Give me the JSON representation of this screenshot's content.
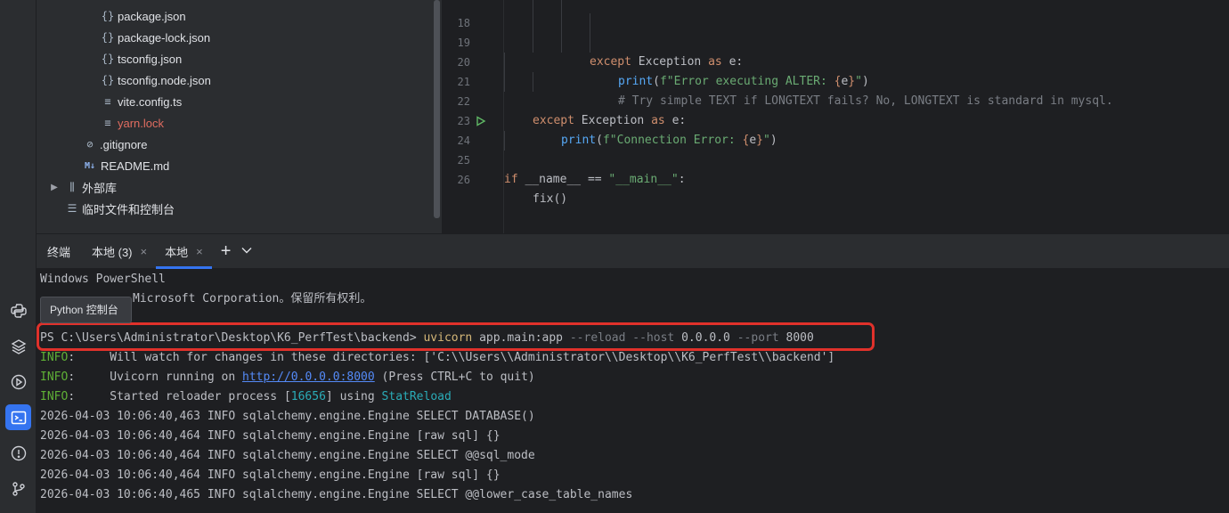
{
  "project_tree": {
    "items": [
      {
        "name": "package.json",
        "type": "json"
      },
      {
        "name": "package-lock.json",
        "type": "json"
      },
      {
        "name": "tsconfig.json",
        "type": "json"
      },
      {
        "name": "tsconfig.node.json",
        "type": "json"
      },
      {
        "name": "vite.config.ts",
        "type": "ts"
      },
      {
        "name": "yarn.lock",
        "type": "lock"
      },
      {
        "name": ".gitignore",
        "type": "gitignore"
      },
      {
        "name": "README.md",
        "type": "md"
      },
      {
        "name": "外部库",
        "type": "library"
      },
      {
        "name": "临时文件和控制台",
        "type": "scratch"
      }
    ],
    "md_badge": "M↓"
  },
  "editor": {
    "line_numbers": [
      "18",
      "19",
      "20",
      "21",
      "22",
      "23",
      "24",
      "25",
      "26"
    ],
    "lines": {
      "l18": {
        "kw": "except",
        "cls": "Exception",
        "as": "as",
        "var": "e:"
      },
      "l19": {
        "fn": "print",
        "open": "(",
        "fprefix": "f",
        "str": "\"Error executing ALTER: ",
        "brace_open": "{",
        "var": "e",
        "brace_close": "}",
        "str_end": "\"",
        "close": ")"
      },
      "l20": {
        "comment": "# Try simple TEXT if LONGTEXT fails? No, LONGTEXT is standard in mysql."
      },
      "l21": {
        "kw": "except",
        "cls": "Exception",
        "as": "as",
        "var": "e:"
      },
      "l22": {
        "fn": "print",
        "open": "(",
        "fprefix": "f",
        "str": "\"Connection Error: ",
        "brace_open": "{",
        "var": "e",
        "brace_close": "}",
        "str_end": "\"",
        "close": ")"
      },
      "l24": {
        "kw": "if",
        "dunder": "__name__",
        "op": "==",
        "str": "\"__main__\"",
        "colon": ":"
      },
      "l25": {
        "call": "fix()"
      }
    }
  },
  "terminal": {
    "title": "终端",
    "tabs": [
      {
        "label": "本地 (3)",
        "active": false
      },
      {
        "label": "本地",
        "active": true
      }
    ],
    "close_glyph": "×",
    "add_glyph": "+",
    "dropdown_glyph": "⌄",
    "lines": {
      "l1": "Windows PowerShell",
      "l2": "Microsoft Corporation。保留所有权利。",
      "prompt": "PS C:\\Users\\Administrator\\Desktop\\K6_PerfTest\\backend> ",
      "cmd_exe": "uvicorn",
      "cmd_app": " app.main:app ",
      "cmd_reload": "--reload",
      "cmd_host_flag": " --host ",
      "cmd_host": "0.0.0.0",
      "cmd_port_flag": " --port ",
      "cmd_port": "8000",
      "info_label": "INFO",
      "info1": "Will watch for changes in these directories: ['C:\\\\Users\\\\Administrator\\\\Desktop\\\\K6_PerfTest\\\\backend']",
      "info2_pre": "Uvicorn running on ",
      "info2_url": "http://0.0.0.0:8000",
      "info2_post": " (Press CTRL+C to quit)",
      "info3_pre": "Started reloader process [",
      "info3_pid": "16656",
      "info3_mid": "] using ",
      "info3_reload": "StatReload",
      "log1": "2026-04-03 10:06:40,463 INFO sqlalchemy.engine.Engine SELECT DATABASE()",
      "log2": "2026-04-03 10:06:40,464 INFO sqlalchemy.engine.Engine [raw sql] {}",
      "log3": "2026-04-03 10:06:40,464 INFO sqlalchemy.engine.Engine SELECT @@sql_mode",
      "log4": "2026-04-03 10:06:40,464 INFO sqlalchemy.engine.Engine [raw sql] {}",
      "log5": "2026-04-03 10:06:40,465 INFO sqlalchemy.engine.Engine SELECT @@lower_case_table_names"
    }
  },
  "tooltip": {
    "text": "Python 控制台"
  },
  "colors": {
    "accent": "#3574f0",
    "highlight_box": "#e0312b",
    "info": "#5fb036"
  },
  "activity_bar": {
    "icons": [
      "python-console-icon",
      "layers-icon",
      "run-icon",
      "terminal-icon",
      "problems-icon",
      "git-icon"
    ]
  }
}
